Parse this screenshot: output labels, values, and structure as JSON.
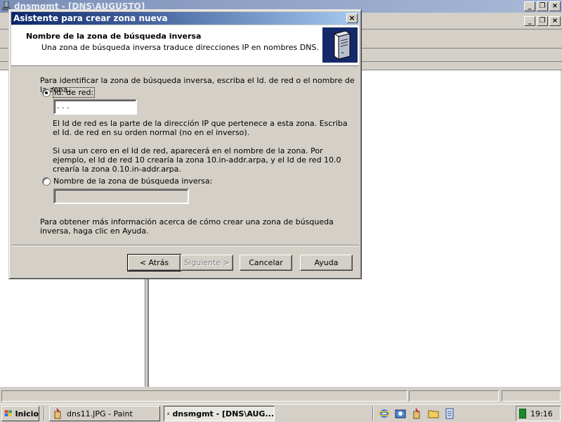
{
  "background_window": {
    "title": "dnsmgmt - [DNS\\AUGUSTO]"
  },
  "dialog": {
    "title": "Asistente para crear zona nueva",
    "close_glyph": "×",
    "header": {
      "title": "Nombre de la zona de búsqueda inversa",
      "subtitle": "Una zona de búsqueda inversa traduce direcciones IP en nombres DNS."
    },
    "intro": "Para identificar la zona de búsqueda inversa, escriba el Id. de red o el nombre de la zona.",
    "option_network_id": {
      "label": "Id. de red:",
      "selected": true,
      "value": "  .  .  .",
      "description_1": "El Id de red es la parte de la dirección IP que pertenece a esta zona. Escriba el Id. de red en su orden normal (no en el inverso).",
      "description_2": "Si usa un cero en el Id de red, aparecerá en el nombre de la zona.  Por ejemplo, el Id de red 10 crearía la zona 10.in-addr.arpa, y el Id de red 10.0 crearía la zona 0.10.in-addr.arpa."
    },
    "option_zone_name": {
      "label": "Nombre de la zona de búsqueda inversa:",
      "selected": false,
      "value": ""
    },
    "help_text": "Para obtener más información acerca de cómo crear una zona de búsqueda inversa, haga clic en Ayuda.",
    "buttons": {
      "back": "< Atrás",
      "next": "Siguiente >",
      "cancel": "Cancelar",
      "help": "Ayuda"
    }
  },
  "taskbar": {
    "start": "Inicio",
    "tasks": [
      {
        "label": "dns11.JPG - Paint",
        "active": false
      },
      {
        "label": "dnsmgmt - [DNS\\AUG...",
        "active": true
      }
    ],
    "clock": "19:16"
  },
  "colors": {
    "title_active": "#0a246a",
    "title_inactive": "#7b8fb7",
    "face": "#d4d0c8"
  }
}
